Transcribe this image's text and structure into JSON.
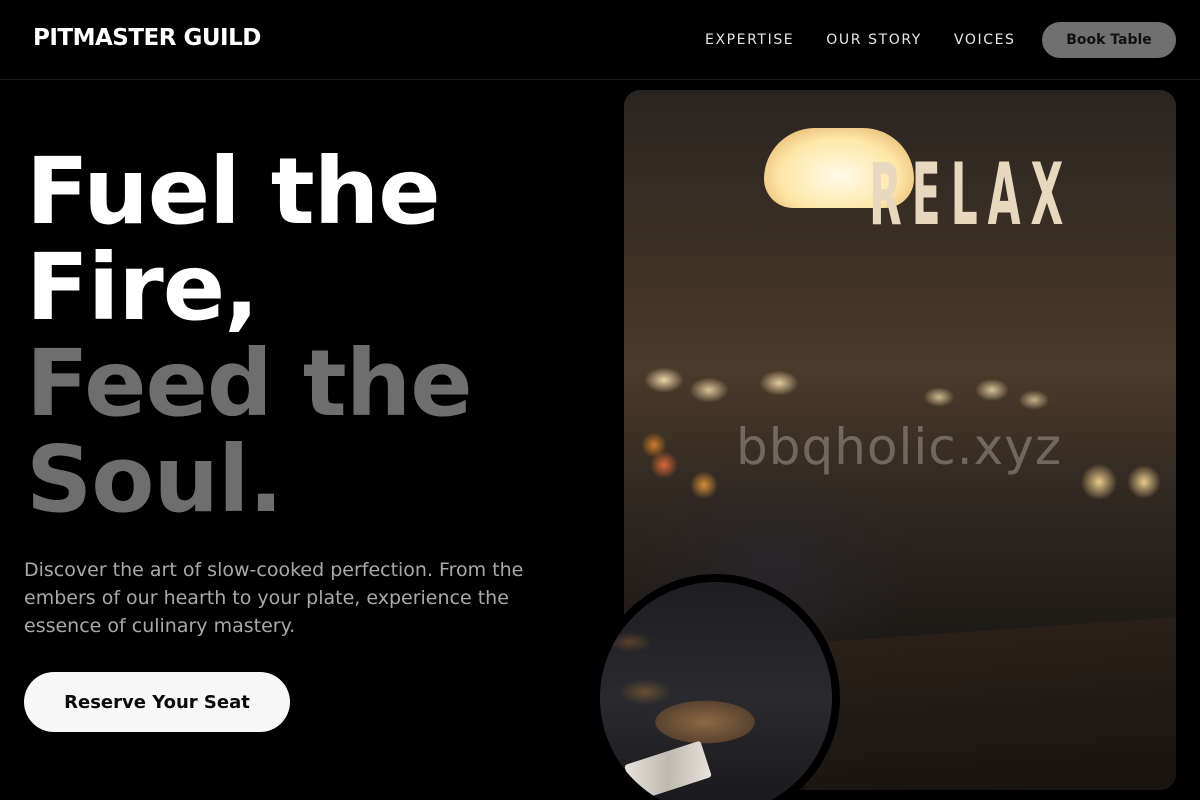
{
  "nav": {
    "brand": "PITMASTER GUILD",
    "links": [
      {
        "label": "EXPERTISE"
      },
      {
        "label": "OUR STORY"
      },
      {
        "label": "VOICES"
      }
    ],
    "cta": "Book Table"
  },
  "hero": {
    "title_lines": [
      "Fuel the",
      "Fire,",
      "Feed the",
      "Soul."
    ],
    "description": "Discover the art of slow-cooked perfection. From the embers of our hearth to your plate, experience the essence of culinary mastery.",
    "cta": "Reserve Your Seat"
  },
  "image": {
    "sign_text": "RELAX",
    "watermark": "bbqholic.xyz"
  },
  "colors": {
    "background": "#000000",
    "title_primary": "#ffffff",
    "title_secondary": "#6e6e6e",
    "body_text": "#a9a9a9",
    "book_button": "#707070",
    "reserve_button": "#f7f7f7"
  }
}
